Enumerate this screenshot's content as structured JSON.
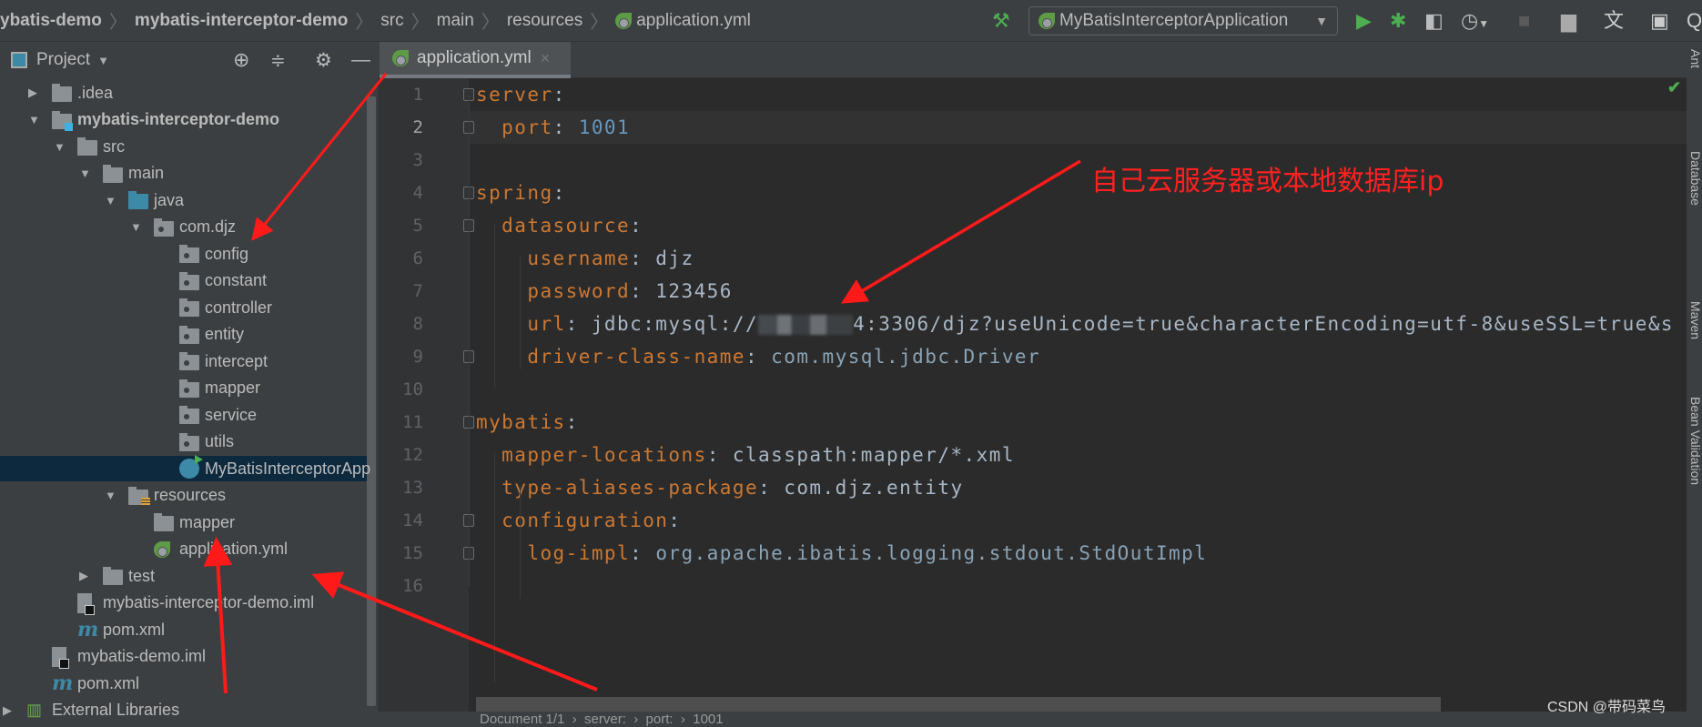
{
  "breadcrumb": [
    "ybatis-demo",
    "mybatis-interceptor-demo",
    "src",
    "main",
    "resources",
    "application.yml"
  ],
  "toolbar": {
    "run_config": "MyBatisInterceptorApplication",
    "icons": [
      "hammer-icon",
      "run-icon",
      "debug-icon",
      "coverage-icon",
      "profile-icon",
      "stop-icon",
      "project-structure-icon",
      "translate-icon",
      "terminal-icon",
      "search-icon"
    ]
  },
  "project_panel": {
    "title": "Project"
  },
  "tree": [
    {
      "label": ".idea",
      "depth": 0,
      "type": "folder",
      "arrow": "right"
    },
    {
      "label": "mybatis-interceptor-demo",
      "depth": 0,
      "type": "module",
      "arrow": "down",
      "bold": true
    },
    {
      "label": "src",
      "depth": 1,
      "type": "folder",
      "arrow": "down"
    },
    {
      "label": "main",
      "depth": 2,
      "type": "folder",
      "arrow": "down"
    },
    {
      "label": "java",
      "depth": 3,
      "type": "java",
      "arrow": "down"
    },
    {
      "label": "com.djz",
      "depth": 4,
      "type": "pkg",
      "arrow": "down"
    },
    {
      "label": "config",
      "depth": 5,
      "type": "pkg"
    },
    {
      "label": "constant",
      "depth": 5,
      "type": "pkg"
    },
    {
      "label": "controller",
      "depth": 5,
      "type": "pkg"
    },
    {
      "label": "entity",
      "depth": 5,
      "type": "pkg"
    },
    {
      "label": "intercept",
      "depth": 5,
      "type": "pkg"
    },
    {
      "label": "mapper",
      "depth": 5,
      "type": "pkg"
    },
    {
      "label": "service",
      "depth": 5,
      "type": "pkg"
    },
    {
      "label": "utils",
      "depth": 5,
      "type": "pkg"
    },
    {
      "label": "MyBatisInterceptorApp",
      "depth": 5,
      "type": "class",
      "selected": true
    },
    {
      "label": "resources",
      "depth": 3,
      "type": "res",
      "arrow": "down"
    },
    {
      "label": "mapper",
      "depth": 4,
      "type": "folder"
    },
    {
      "label": "application.yml",
      "depth": 4,
      "type": "yml"
    },
    {
      "label": "test",
      "depth": 2,
      "type": "folder",
      "arrow": "right"
    },
    {
      "label": "mybatis-interceptor-demo.iml",
      "depth": 1,
      "type": "iml"
    },
    {
      "label": "pom.xml",
      "depth": 1,
      "type": "maven"
    },
    {
      "label": "mybatis-demo.iml",
      "depth": 0,
      "type": "iml"
    },
    {
      "label": "pom.xml",
      "depth": 0,
      "type": "maven"
    },
    {
      "label": "External Libraries",
      "depth": -1,
      "type": "lib",
      "arrow": "right"
    }
  ],
  "editor": {
    "tab": "application.yml",
    "current_line": 2,
    "lines": [
      [
        {
          "t": "server",
          "c": "k"
        },
        {
          "t": ":",
          "c": "v"
        }
      ],
      [
        {
          "t": "  port",
          "c": "k"
        },
        {
          "t": ": ",
          "c": "v"
        },
        {
          "t": "1001",
          "c": "n"
        }
      ],
      [],
      [
        {
          "t": "spring",
          "c": "k"
        },
        {
          "t": ":",
          "c": "v"
        }
      ],
      [
        {
          "t": "  datasource",
          "c": "k"
        },
        {
          "t": ":",
          "c": "v"
        }
      ],
      [
        {
          "t": "    username",
          "c": "k"
        },
        {
          "t": ": djz",
          "c": "v"
        }
      ],
      [
        {
          "t": "    password",
          "c": "k"
        },
        {
          "t": ": 123456",
          "c": "v"
        }
      ],
      [
        {
          "t": "    url",
          "c": "k"
        },
        {
          "t": ": jdbc:mysql://",
          "c": "v"
        },
        {
          "blur": true
        },
        {
          "t": "4:3306/djz?useUnicode=true&characterEncoding=utf-8&useSSL=true&s",
          "c": "v"
        }
      ],
      [
        {
          "t": "    driver-class-name",
          "c": "k"
        },
        {
          "t": ": ",
          "c": "v"
        },
        {
          "t": "com.mysql.jdbc.Driver",
          "c": "c"
        }
      ],
      [],
      [
        {
          "t": "mybatis",
          "c": "k"
        },
        {
          "t": ":",
          "c": "v"
        }
      ],
      [
        {
          "t": "  mapper-locations",
          "c": "k"
        },
        {
          "t": ": classpath:mapper/*.xml",
          "c": "v"
        }
      ],
      [
        {
          "t": "  type-aliases-package",
          "c": "k"
        },
        {
          "t": ": com.djz.entity",
          "c": "v"
        }
      ],
      [
        {
          "t": "  configuration",
          "c": "k"
        },
        {
          "t": ":",
          "c": "v"
        }
      ],
      [
        {
          "t": "    log-impl",
          "c": "k"
        },
        {
          "t": ": ",
          "c": "v"
        },
        {
          "t": "org.apache.ibatis.logging.stdout.StdOutImpl",
          "c": "c"
        }
      ],
      []
    ]
  },
  "status_breadcrumb": "Document 1/1  ›  server:  ›  port:  ›  1001",
  "right_tools": [
    "Ant",
    "Database",
    "Maven",
    "Bean Validation"
  ],
  "annotation": "自己云服务器或本地数据库ip",
  "watermark": "CSDN @带码菜鸟",
  "colors": {
    "key": "#cc7832",
    "number": "#6897bb",
    "annotation": "#ff2020",
    "selection": "#0d293e"
  }
}
